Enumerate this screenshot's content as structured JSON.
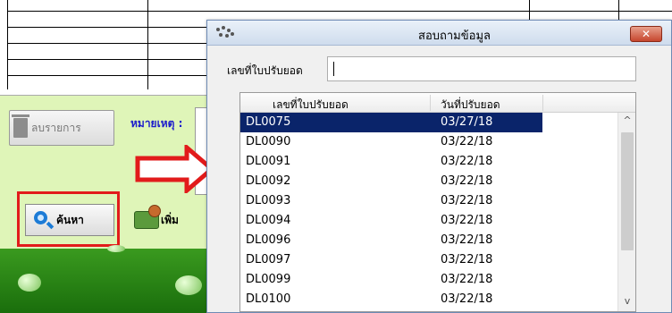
{
  "background": {
    "delete_label": "ลบรายการ",
    "remark_label": "หมายเหตุ :",
    "search_label": "ค้นหา",
    "add_label": "เพิ่ม"
  },
  "dialog": {
    "title": "สอบถามข้อมูล",
    "close_symbol": "✕",
    "field_label": "เลขที่ใบปรับยอด",
    "field_value": "",
    "columns": [
      "เลขที่ใบปรับยอด",
      "วันที่ปรับยอด"
    ],
    "rows": [
      {
        "doc_no": "DL0075",
        "date": "03/27/18",
        "selected": true
      },
      {
        "doc_no": "DL0090",
        "date": "03/22/18"
      },
      {
        "doc_no": "DL0091",
        "date": "03/22/18"
      },
      {
        "doc_no": "DL0092",
        "date": "03/22/18"
      },
      {
        "doc_no": "DL0093",
        "date": "03/22/18"
      },
      {
        "doc_no": "DL0094",
        "date": "03/22/18"
      },
      {
        "doc_no": "DL0096",
        "date": "03/22/18"
      },
      {
        "doc_no": "DL0097",
        "date": "03/22/18"
      },
      {
        "doc_no": "DL0099",
        "date": "03/22/18"
      },
      {
        "doc_no": "DL0100",
        "date": "03/22/18"
      }
    ],
    "scroll_up_symbol": "^",
    "scroll_down_symbol": "v"
  },
  "colors": {
    "selection": "#0a246a",
    "annotation_red": "#e21b1b",
    "panel_green": "#dff5b8"
  }
}
